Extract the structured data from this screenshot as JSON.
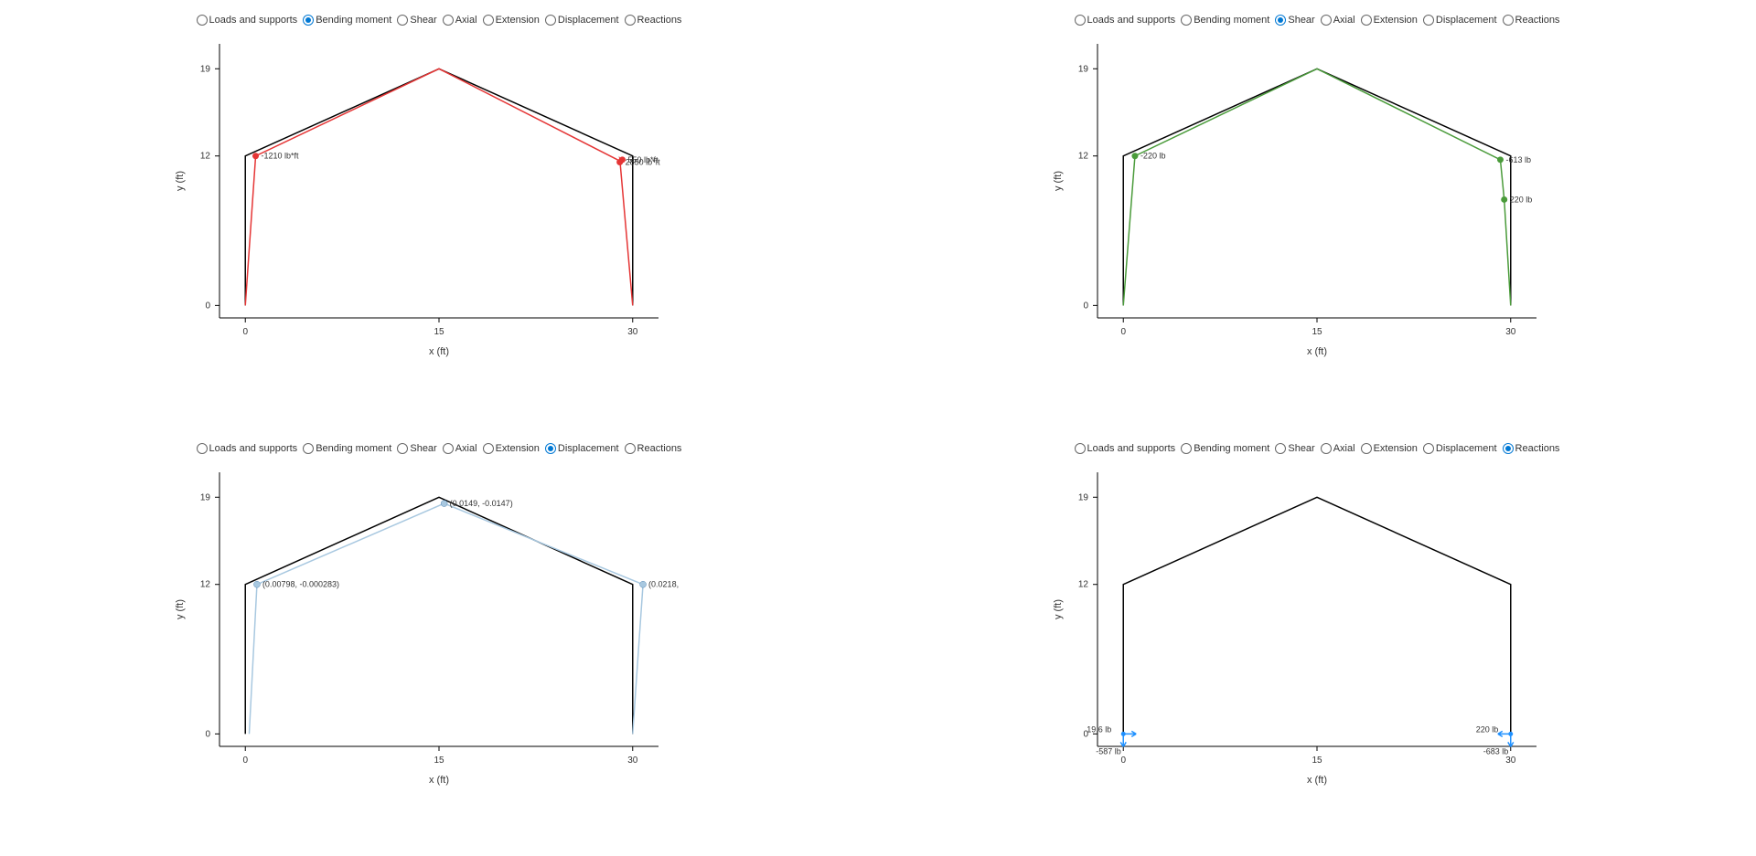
{
  "radios": [
    "Loads and supports",
    "Bending moment",
    "Shear",
    "Axial",
    "Extension",
    "Displacement",
    "Reactions"
  ],
  "axes": {
    "xlabel": "x (ft)",
    "ylabel": "y (ft)",
    "xticks": [
      0,
      15,
      30
    ],
    "yticks": [
      0,
      12,
      19
    ]
  },
  "chart_data": [
    {
      "type": "line",
      "title": "Bending moment",
      "selected": "Bending moment",
      "frame": [
        [
          0,
          0
        ],
        [
          0,
          12
        ],
        [
          15,
          19
        ],
        [
          30,
          12
        ],
        [
          30,
          0
        ]
      ],
      "overlay_color": "red",
      "overlay": [
        [
          0,
          0
        ],
        [
          0.8,
          12
        ],
        [
          15,
          19
        ],
        [
          29.2,
          11.5
        ],
        [
          29,
          11.8
        ],
        [
          30,
          0
        ]
      ],
      "points": [
        {
          "x": 0.8,
          "y": 12,
          "label": "-1210 lb*ft"
        },
        {
          "x": 29.2,
          "y": 11.7,
          "label": "550 lb*ft"
        },
        {
          "x": 29,
          "y": 11.5,
          "label": "2850 lb*ft"
        }
      ]
    },
    {
      "type": "line",
      "title": "Shear",
      "selected": "Shear",
      "frame": [
        [
          0,
          0
        ],
        [
          0,
          12
        ],
        [
          15,
          19
        ],
        [
          30,
          12
        ],
        [
          30,
          0
        ]
      ],
      "overlay_color": "green",
      "overlay": [
        [
          0,
          0
        ],
        [
          0.9,
          12
        ],
        [
          15,
          19
        ],
        [
          29.2,
          11.7
        ],
        [
          29.5,
          8.5
        ],
        [
          30,
          0
        ]
      ],
      "points": [
        {
          "x": 0.9,
          "y": 12,
          "label": "-220 lb"
        },
        {
          "x": 29.2,
          "y": 11.7,
          "label": "-613 lb"
        },
        {
          "x": 29.5,
          "y": 8.5,
          "label": "220 lb"
        }
      ]
    },
    {
      "type": "line",
      "title": "Displacement",
      "selected": "Displacement",
      "frame": [
        [
          0,
          0
        ],
        [
          0,
          12
        ],
        [
          15,
          19
        ],
        [
          30,
          12
        ],
        [
          30,
          0
        ]
      ],
      "overlay_color": "blue",
      "overlay": [
        [
          0.3,
          0
        ],
        [
          0.9,
          12
        ],
        [
          15.4,
          18.5
        ],
        [
          30.8,
          12
        ],
        [
          30,
          0
        ]
      ],
      "points": [
        {
          "x": 0.9,
          "y": 12,
          "label": "(0.00798, -0.000283)"
        },
        {
          "x": 15.4,
          "y": 18.5,
          "label": "(0.0149, -0.0147)"
        },
        {
          "x": 30.8,
          "y": 12,
          "label": "(0.0218,"
        }
      ]
    },
    {
      "type": "line",
      "title": "Reactions",
      "selected": "Reactions",
      "frame": [
        [
          0,
          0
        ],
        [
          0,
          12
        ],
        [
          15,
          19
        ],
        [
          30,
          12
        ],
        [
          30,
          0
        ]
      ],
      "reactions": [
        {
          "x": 0,
          "y": 0,
          "hx": "19.6 lb",
          "vy": "-587 lb"
        },
        {
          "x": 30,
          "y": 0,
          "hx": "220 lb",
          "vy": "-683 lb"
        }
      ]
    }
  ]
}
